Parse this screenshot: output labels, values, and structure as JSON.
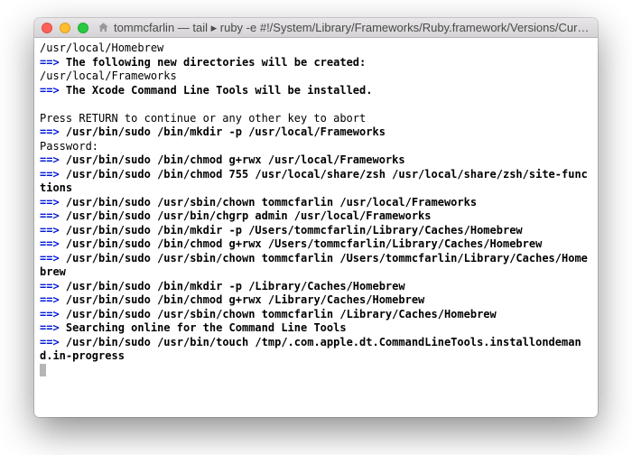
{
  "window": {
    "title": "tommcfarlin — tail ▸ ruby -e #!/System/Library/Frameworks/Ruby.framework/Versions/Curren..."
  },
  "arrow": "==>",
  "lines": [
    {
      "type": "plain",
      "text": "/usr/local/Homebrew"
    },
    {
      "type": "arrow_bold",
      "text": "The following new directories will be created:"
    },
    {
      "type": "plain",
      "text": "/usr/local/Frameworks"
    },
    {
      "type": "arrow_bold",
      "text": "The Xcode Command Line Tools will be installed."
    },
    {
      "type": "blank",
      "text": ""
    },
    {
      "type": "plain",
      "text": "Press RETURN to continue or any other key to abort"
    },
    {
      "type": "arrow_bold",
      "text": "/usr/bin/sudo /bin/mkdir -p /usr/local/Frameworks"
    },
    {
      "type": "plain",
      "text": "Password:"
    },
    {
      "type": "arrow_bold",
      "text": "/usr/bin/sudo /bin/chmod g+rwx /usr/local/Frameworks"
    },
    {
      "type": "arrow_bold",
      "text": "/usr/bin/sudo /bin/chmod 755 /usr/local/share/zsh /usr/local/share/zsh/site-functions"
    },
    {
      "type": "arrow_bold",
      "text": "/usr/bin/sudo /usr/sbin/chown tommcfarlin /usr/local/Frameworks"
    },
    {
      "type": "arrow_bold",
      "text": "/usr/bin/sudo /usr/bin/chgrp admin /usr/local/Frameworks"
    },
    {
      "type": "arrow_bold",
      "text": "/usr/bin/sudo /bin/mkdir -p /Users/tommcfarlin/Library/Caches/Homebrew"
    },
    {
      "type": "arrow_bold",
      "text": "/usr/bin/sudo /bin/chmod g+rwx /Users/tommcfarlin/Library/Caches/Homebrew"
    },
    {
      "type": "arrow_bold",
      "text": "/usr/bin/sudo /usr/sbin/chown tommcfarlin /Users/tommcfarlin/Library/Caches/Homebrew"
    },
    {
      "type": "arrow_bold",
      "text": "/usr/bin/sudo /bin/mkdir -p /Library/Caches/Homebrew"
    },
    {
      "type": "arrow_bold",
      "text": "/usr/bin/sudo /bin/chmod g+rwx /Library/Caches/Homebrew"
    },
    {
      "type": "arrow_bold",
      "text": "/usr/bin/sudo /usr/sbin/chown tommcfarlin /Library/Caches/Homebrew"
    },
    {
      "type": "arrow_bold",
      "text": "Searching online for the Command Line Tools"
    },
    {
      "type": "arrow_bold",
      "text": "/usr/bin/sudo /usr/bin/touch /tmp/.com.apple.dt.CommandLineTools.installondemand.in-progress"
    }
  ]
}
